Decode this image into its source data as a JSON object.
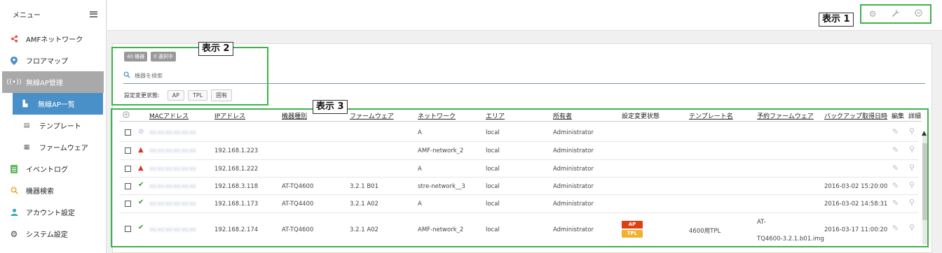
{
  "sidebar": {
    "title": "メニュー",
    "items": [
      {
        "label": "AMFネットワーク",
        "icon": "share-icon",
        "color": "#e0533c"
      },
      {
        "label": "フロアマップ",
        "icon": "map-pin-icon",
        "color": "#4a90c8"
      },
      {
        "label": "無線AP管理",
        "icon": "wireless-icon",
        "color": "#ffffff"
      },
      {
        "label": "無線AP一覧",
        "icon": "ap-list-icon"
      },
      {
        "label": "テンプレート",
        "icon": "template-icon"
      },
      {
        "label": "ファームウェア",
        "icon": "firmware-icon"
      },
      {
        "label": "イベントログ",
        "icon": "document-icon",
        "color": "#5cb85c"
      },
      {
        "label": "機器検索",
        "icon": "search-icon",
        "color": "#f0a030"
      },
      {
        "label": "アカウント設定",
        "icon": "user-icon",
        "color": "#3aaab5"
      },
      {
        "label": "システム設定",
        "icon": "gear-icon",
        "color": "#444444"
      }
    ]
  },
  "callouts": {
    "c1": "表示 1",
    "c2": "表示 2",
    "c3": "表示 3"
  },
  "summary": {
    "count": "40 機器",
    "selected": "0 選択中"
  },
  "search": {
    "placeholder": "機器を検索"
  },
  "filter": {
    "label": "設定変更状態:",
    "buttons": [
      "AP",
      "TPL",
      "固有"
    ]
  },
  "table": {
    "columns": [
      "MACアドレス",
      "IPアドレス",
      "機器種別",
      "ファームウェア",
      "ネットワーク",
      "エリア",
      "所有者",
      "設定変更状態",
      "テンプレート名",
      "予約ファームウェア",
      "バックアップ取得日時",
      "編集",
      "詳細"
    ],
    "rows": [
      {
        "status": "unknown",
        "mac": "xx:xx:xx:xx:xx:xx",
        "ip": "",
        "model": "",
        "fw": "",
        "net": "A",
        "area": "local",
        "owner": "Administrator",
        "tpl": "",
        "rfw": "",
        "backup": ""
      },
      {
        "status": "warning",
        "mac": "xx:xx:xx:xx:xx:xx",
        "ip": "192.168.1.223",
        "model": "",
        "fw": "",
        "net": "AMF-network_2",
        "area": "local",
        "owner": "Administrator",
        "tpl": "",
        "rfw": "",
        "backup": ""
      },
      {
        "status": "warning",
        "mac": "xx:xx:xx:xx:xx:xx",
        "ip": "192.168.1.222",
        "model": "",
        "fw": "",
        "net": "A",
        "area": "local",
        "owner": "Administrator",
        "tpl": "",
        "rfw": "",
        "backup": ""
      },
      {
        "status": "ok",
        "mac": "xx:xx:xx:xx:xx:xx",
        "ip": "192.168.3.118",
        "model": "AT-TQ4600",
        "fw": "3.2.1 B01",
        "net": "stre-network__3",
        "area": "local",
        "owner": "Administrator",
        "tpl": "",
        "rfw": "",
        "backup": "2016-03-02 15:20:00"
      },
      {
        "status": "ok",
        "mac": "xx:xx:xx:xx:xx:xx",
        "ip": "192.168.1.173",
        "model": "AT-TQ4400",
        "fw": "3.2.1 A02",
        "net": "A",
        "area": "local",
        "owner": "Administrator",
        "tpl": "",
        "rfw": "",
        "backup": "2016-03-02 14:58:31"
      },
      {
        "status": "ok",
        "mac": "xx:xx:xx:xx:xx:xx",
        "ip": "192.168.2.174",
        "model": "AT-TQ4600",
        "fw": "3.2.1 A02",
        "net": "AMF-network_2",
        "area": "local",
        "owner": "Administrator",
        "tags": [
          "AP",
          "TPL"
        ],
        "tpl": "4600用TPL",
        "rfw1": "AT-",
        "rfw2": "TQ4600-3.2.1.b01.img",
        "backup": "2016-03-17 11:00:20"
      }
    ]
  },
  "colors": {
    "accent": "#4a90c8",
    "highlight": "#3cb44b",
    "warning": "#d9342b",
    "ok": "#2a9a3a"
  }
}
